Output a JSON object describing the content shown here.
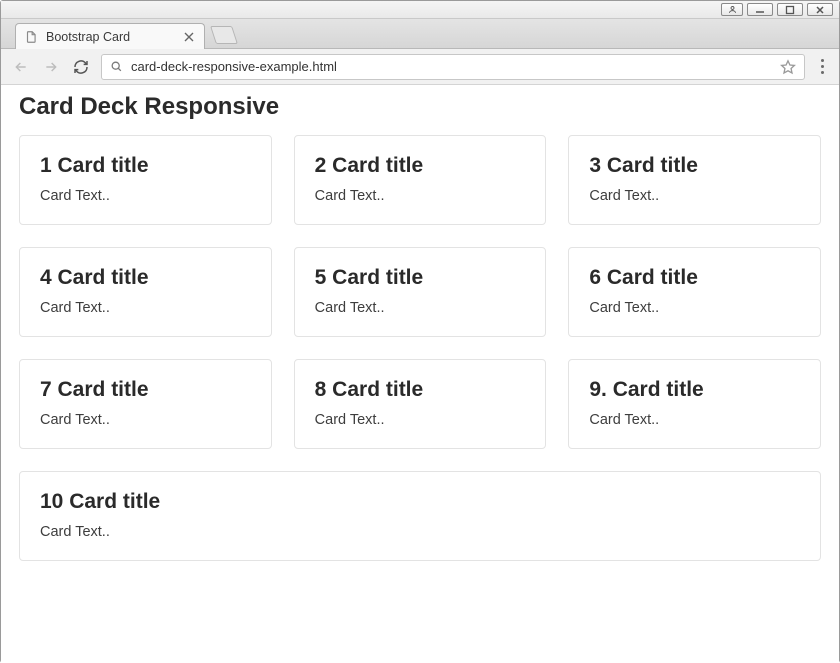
{
  "browser": {
    "tab_title": "Bootstrap Card",
    "address": "card-deck-responsive-example.html"
  },
  "page": {
    "heading": "Card Deck Responsive",
    "cards": [
      {
        "title": "1 Card title",
        "text": "Card Text.."
      },
      {
        "title": "2 Card title",
        "text": "Card Text.."
      },
      {
        "title": "3 Card title",
        "text": "Card Text.."
      },
      {
        "title": "4 Card title",
        "text": "Card Text.."
      },
      {
        "title": "5 Card title",
        "text": "Card Text.."
      },
      {
        "title": "6 Card title",
        "text": "Card Text.."
      },
      {
        "title": "7 Card title",
        "text": "Card Text.."
      },
      {
        "title": "8 Card title",
        "text": "Card Text.."
      },
      {
        "title": "9. Card title",
        "text": "Card Text.."
      },
      {
        "title": "10 Card title",
        "text": "Card Text.."
      }
    ]
  }
}
